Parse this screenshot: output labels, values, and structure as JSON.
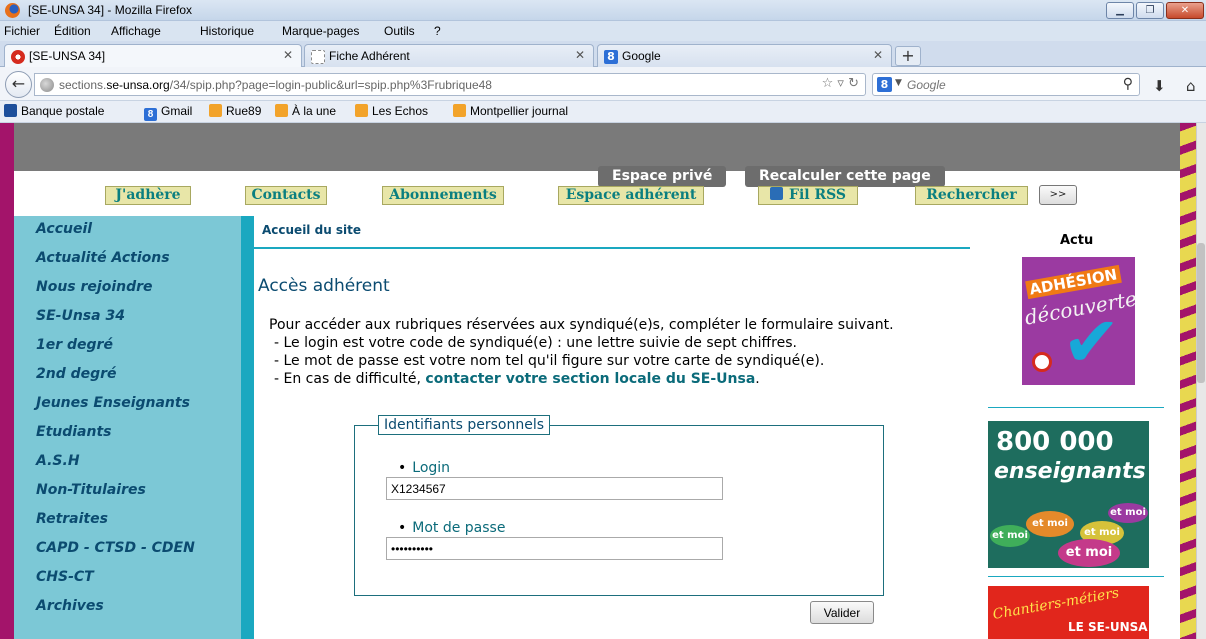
{
  "window": {
    "title": "[SE-UNSA 34] - Mozilla Firefox"
  },
  "menubar": {
    "items": [
      "Fichier",
      "Édition",
      "Affichage",
      "Historique",
      "Marque-pages",
      "Outils",
      "?"
    ]
  },
  "tabs": [
    {
      "label": "[SE-UNSA 34]",
      "active": true
    },
    {
      "label": "Fiche Adhérent",
      "active": false
    },
    {
      "label": "Google",
      "active": false
    }
  ],
  "navbar": {
    "url_prefix": "sections.",
    "url_domain": "se-unsa.org",
    "url_path": "/34/spip.php?page=login-public&url=spip.php%3Frubrique48",
    "search_placeholder": "Google"
  },
  "bookmarks": [
    "Banque postale",
    "Gmail",
    "Rue89",
    "À la une",
    "Les Echos",
    "Montpellier journal"
  ],
  "site": {
    "top_buttons": [
      "Espace privé",
      "Recalculer cette page"
    ],
    "nav_tabs": [
      "J'adhère",
      "Contacts",
      "Abonnements",
      "Espace adhérent",
      "Fil RSS",
      "Rechercher"
    ],
    "nav_more": ">>",
    "sidebar": [
      "Accueil",
      "Actualité Actions",
      "Nous rejoindre",
      "SE-Unsa 34",
      "1er degré",
      "2nd degré",
      "Jeunes Enseignants",
      "Etudiants",
      "A.S.H",
      "Non-Titulaires",
      "Retraites",
      "CAPD - CTSD - CDEN",
      "CHS-CT",
      "Archives"
    ],
    "breadcrumb": "Accueil du site",
    "page_title": "Accès adhérent",
    "intro": {
      "line1": "Pour accéder aux rubriques réservées aux syndiqué(e)s, compléter le formulaire suivant.",
      "line2": "- Le login est votre code de syndiqué(e) : une lettre suivie de sept chiffres.",
      "line3": "- Le mot de passe est votre nom tel qu'il figure sur votre carte de syndiqué(e).",
      "line4_prefix": "- En cas de difficulté, ",
      "line4_link": "contacter votre section locale du SE-Unsa",
      "line4_suffix": "."
    },
    "form": {
      "legend": "Identifiants personnels",
      "login_label": "Login",
      "login_value": "X1234567",
      "password_label": "Mot de passe",
      "password_value": "••••••••••",
      "submit_label": "Valider"
    },
    "right": {
      "actu_title": "Actu",
      "adhesion_line1": "ADHÉSION",
      "adhesion_line2": "découverte",
      "ens_line1": "800 000",
      "ens_line2": "enseignants",
      "bubble_text": "et moi",
      "chantiers_line1": "Chantiers-métiers",
      "chantiers_line2": "LE SE-UNSA"
    }
  }
}
